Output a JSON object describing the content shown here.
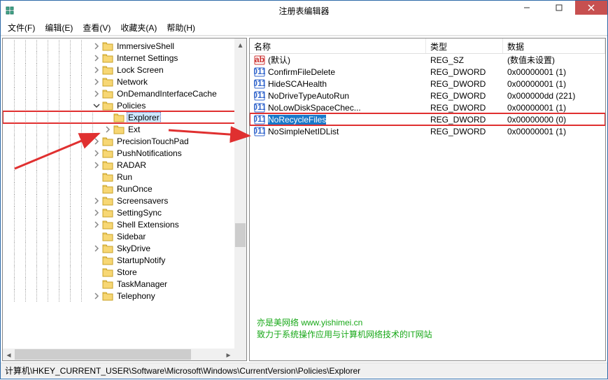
{
  "window": {
    "title": "注册表编辑器"
  },
  "menubar": [
    {
      "label": "文件(F)"
    },
    {
      "label": "编辑(E)"
    },
    {
      "label": "查看(V)"
    },
    {
      "label": "收藏夹(A)"
    },
    {
      "label": "帮助(H)"
    }
  ],
  "tree": {
    "base_depth": 8,
    "items": [
      {
        "label": "ImmersiveShell",
        "exp": "closed"
      },
      {
        "label": "Internet Settings",
        "exp": "closed"
      },
      {
        "label": "Lock Screen",
        "exp": "closed"
      },
      {
        "label": "Network",
        "exp": "closed"
      },
      {
        "label": "OnDemandInterfaceCache",
        "exp": "closed"
      },
      {
        "label": "Policies",
        "exp": "open"
      },
      {
        "label": "Explorer",
        "exp": "none",
        "extra": 1,
        "selected": true,
        "highlighted": true
      },
      {
        "label": "Ext",
        "exp": "closed",
        "extra": 1
      },
      {
        "label": "PrecisionTouchPad",
        "exp": "closed"
      },
      {
        "label": "PushNotifications",
        "exp": "closed"
      },
      {
        "label": "RADAR",
        "exp": "closed"
      },
      {
        "label": "Run",
        "exp": "none"
      },
      {
        "label": "RunOnce",
        "exp": "none"
      },
      {
        "label": "Screensavers",
        "exp": "closed"
      },
      {
        "label": "SettingSync",
        "exp": "closed"
      },
      {
        "label": "Shell Extensions",
        "exp": "closed"
      },
      {
        "label": "Sidebar",
        "exp": "none"
      },
      {
        "label": "SkyDrive",
        "exp": "closed"
      },
      {
        "label": "StartupNotify",
        "exp": "none"
      },
      {
        "label": "Store",
        "exp": "none"
      },
      {
        "label": "TaskManager",
        "exp": "none"
      },
      {
        "label": "Telephony",
        "exp": "closed"
      }
    ]
  },
  "list": {
    "headers": {
      "name": "名称",
      "type": "类型",
      "data": "数据"
    },
    "rows": [
      {
        "icon": "ab",
        "name": "(默认)",
        "type": "REG_SZ",
        "data": "(数值未设置)"
      },
      {
        "icon": "bin",
        "name": "ConfirmFileDelete",
        "type": "REG_DWORD",
        "data": "0x00000001 (1)"
      },
      {
        "icon": "bin",
        "name": "HideSCAHealth",
        "type": "REG_DWORD",
        "data": "0x00000001 (1)"
      },
      {
        "icon": "bin",
        "name": "NoDriveTypeAutoRun",
        "type": "REG_DWORD",
        "data": "0x000000dd (221)"
      },
      {
        "icon": "bin",
        "name": "NoLowDiskSpaceChec...",
        "type": "REG_DWORD",
        "data": "0x00000001 (1)"
      },
      {
        "icon": "bin",
        "name": "NoRecycleFiles",
        "type": "REG_DWORD",
        "data": "0x00000000 (0)",
        "selected": true,
        "highlighted": true
      },
      {
        "icon": "bin",
        "name": "NoSimpleNetIDList",
        "type": "REG_DWORD",
        "data": "0x00000001 (1)"
      }
    ]
  },
  "statusbar": {
    "path": "计算机\\HKEY_CURRENT_USER\\Software\\Microsoft\\Windows\\CurrentVersion\\Policies\\Explorer"
  },
  "watermark": {
    "line1": "亦是美网络 www.yishimei.cn",
    "line2": "致力于系统操作应用与计算机网络技术的IT网站"
  }
}
